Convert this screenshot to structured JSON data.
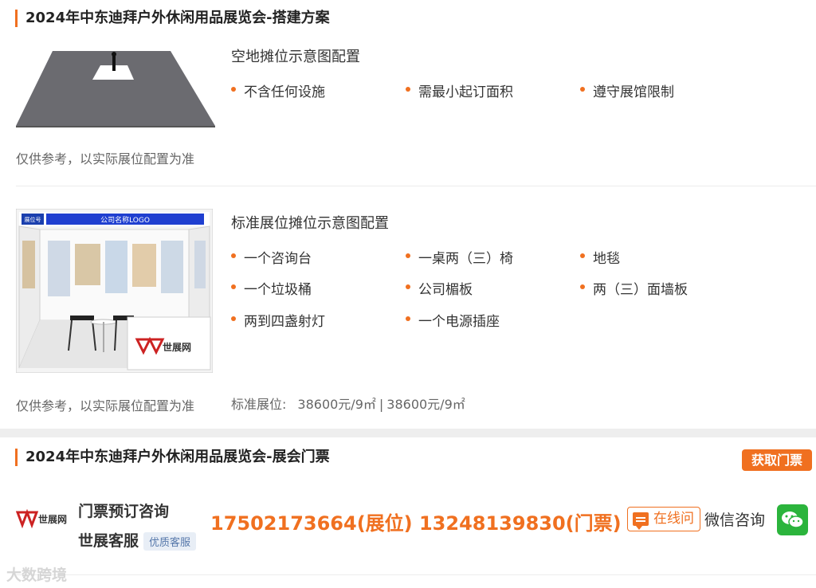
{
  "card1": {
    "title": "2024年中东迪拜户外休闲用品展览会-搭建方案",
    "raw_space": {
      "config_title": "空地摊位示意图配置",
      "features": [
        "不含任何设施",
        "需最小起订面积",
        "遵守展馆限制"
      ],
      "caption": "仅供参考，以实际展位配置为准"
    },
    "standard_booth": {
      "config_title": "标准展位摊位示意图配置",
      "features": [
        "一个咨询台",
        "一桌两（三）椅",
        "地毯",
        "一个垃圾桶",
        "公司楣板",
        "两（三）面墙板",
        "两到四盏射灯",
        "一个电源插座"
      ],
      "caption": "仅供参考，以实际展位配置为准",
      "image_fascia_text": "公司名称LOGO",
      "image_booth_no": "展位号",
      "image_brand": "世展网",
      "price_label": "标准展位:",
      "price_1": "38600元/9㎡",
      "price_sep": "|",
      "price_2": "38600元/9㎡"
    }
  },
  "card2": {
    "title": "2024年中东迪拜户外休闲用品展览会-展会门票",
    "get_ticket_label": "获取门票",
    "logo_text": "世展网",
    "service_line1": "门票预订咨询",
    "service_line2": "世展客服",
    "service_badge": "优质客服",
    "phones": "17502173664(展位) 13248139830(门票)",
    "online_label": "在线问",
    "wechat_label": "微信咨询"
  },
  "watermark": "大数跨境",
  "colors": {
    "accent": "#f07020",
    "wechat": "#2bb43c",
    "page_bg": "#eeeeee"
  }
}
